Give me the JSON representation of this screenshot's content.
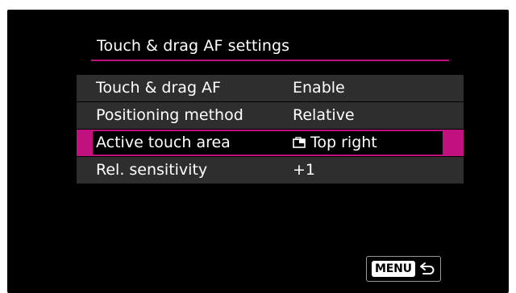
{
  "screen": {
    "title": "Touch & drag AF settings"
  },
  "menu": {
    "items": [
      {
        "label": "Touch & drag AF",
        "value": "Enable",
        "selected": false
      },
      {
        "label": "Positioning method",
        "value": "Relative",
        "selected": false
      },
      {
        "label": "Active touch area",
        "value": "Top right",
        "icon": "touch-area-top-right-icon",
        "selected": true
      },
      {
        "label": "Rel. sensitivity",
        "value": "+1",
        "selected": false
      }
    ]
  },
  "footer": {
    "menu_key_label": "MENU",
    "back_icon": "return-arrow-icon"
  },
  "colors": {
    "background": "#000000",
    "row": "#2e2e2e",
    "accent": "#c0117e",
    "text": "#ffffff"
  }
}
